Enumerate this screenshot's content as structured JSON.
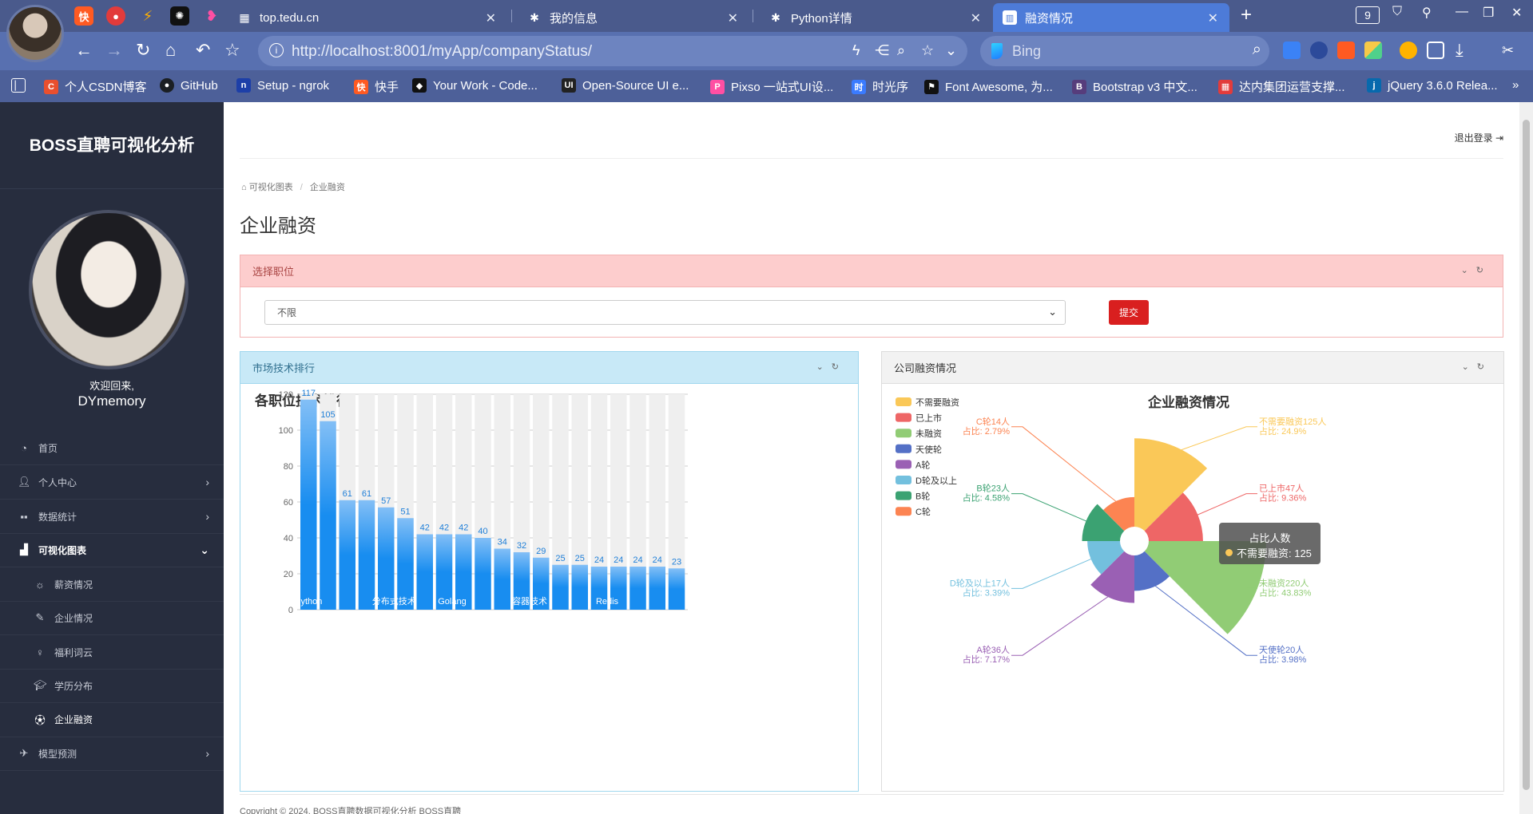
{
  "browser": {
    "tabs": [
      {
        "title": "top.tedu.cn",
        "icon": "grid-icon"
      },
      {
        "title": "我的信息",
        "icon": "bug-icon"
      },
      {
        "title": "Python详情",
        "icon": "bug-icon"
      },
      {
        "title": "融资情况",
        "icon": "trello-icon",
        "active": true
      }
    ],
    "tab_count": "9",
    "url": "http://localhost:8001/myApp/companyStatus/",
    "search_placeholder": "Bing",
    "bookmarks": [
      {
        "label": "个人CSDN博客",
        "color": "#e94f2e",
        "glyph": "C"
      },
      {
        "label": "GitHub",
        "color": "#1b1f23",
        "glyph": "●"
      },
      {
        "label": "Setup - ngrok",
        "color": "#1d3fa8",
        "glyph": "n"
      },
      {
        "label": "快手",
        "color": "#ff5a22",
        "glyph": "快"
      },
      {
        "label": "Your Work - Code...",
        "color": "#111111",
        "glyph": "◆"
      },
      {
        "label": "Open-Source UI e...",
        "color": "#222222",
        "glyph": "UI"
      },
      {
        "label": "Pixso 一站式UI设...",
        "color": "#ff4fa3",
        "glyph": "P"
      },
      {
        "label": "时光序",
        "color": "#3a7bff",
        "glyph": "时"
      },
      {
        "label": "Font Awesome, 为...",
        "color": "#111111",
        "glyph": "⚑"
      },
      {
        "label": "Bootstrap v3 中文...",
        "color": "#563d7c",
        "glyph": "B"
      },
      {
        "label": "达内集团运营支撑...",
        "color": "#e23b3b",
        "glyph": "▦"
      },
      {
        "label": "jQuery 3.6.0 Relea...",
        "color": "#0769ad",
        "glyph": "j"
      }
    ]
  },
  "sidebar": {
    "brand": "BOSS直聘可视化分析",
    "welcome": "欢迎回来,",
    "username": "DYmemory",
    "items": [
      {
        "label": "首页",
        "icon": "dashboard-icon"
      },
      {
        "label": "个人中心",
        "icon": "user-icon"
      },
      {
        "label": "数据统计",
        "icon": "grid-icon"
      },
      {
        "label": "可视化图表",
        "icon": "bar-chart-icon"
      },
      {
        "label": "薪资情况",
        "icon": "sun-icon"
      },
      {
        "label": "企业情况",
        "icon": "feather-icon"
      },
      {
        "label": "福利词云",
        "icon": "bulb-icon"
      },
      {
        "label": "学历分布",
        "icon": "graduation-icon"
      },
      {
        "label": "企业融资",
        "icon": "ball-icon"
      },
      {
        "label": "模型预测",
        "icon": "plane-icon"
      }
    ]
  },
  "header": {
    "logout": "退出登录",
    "breadcrumb_root": "可视化图表",
    "breadcrumb_sep": "/",
    "breadcrumb_current": "企业融资",
    "page_title": "企业融资"
  },
  "filter": {
    "title": "选择职位",
    "selected": "不限",
    "submit": "提交"
  },
  "tech_panel": {
    "title": "市场技术排行"
  },
  "finance_panel": {
    "title": "公司融资情况"
  },
  "tooltip": {
    "title": "占比人数",
    "text": "不需要融资: 125"
  },
  "footer": "Copyright © 2024. BOSS直聘数据可视化分析 BOSS直聘",
  "chart_data": [
    {
      "type": "bar",
      "title": "各职位技术排行",
      "categories": [
        "Python",
        "",
        "",
        "",
        "分布式技术",
        "",
        "",
        "Golang",
        "",
        "",
        "",
        "容器技术",
        "",
        "",
        "",
        "Redis",
        "",
        "",
        "",
        ""
      ],
      "values": [
        117,
        105,
        61,
        61,
        57,
        51,
        42,
        42,
        42,
        40,
        34,
        32,
        29,
        25,
        25,
        24,
        24,
        24,
        24,
        23
      ],
      "ylim": [
        0,
        120
      ],
      "yticks": [
        0,
        20,
        40,
        60,
        80,
        100,
        120
      ],
      "color": "#1f8fef",
      "grid": true
    },
    {
      "type": "pie",
      "title": "企业融资情况",
      "rose": true,
      "legend_position": "top-left",
      "slices": [
        {
          "name": "不需要融资",
          "value": 125,
          "percent": "24.9%",
          "color": "#fac858"
        },
        {
          "name": "已上市",
          "value": 47,
          "percent": "9.36%",
          "color": "#ee6666"
        },
        {
          "name": "未融资",
          "value": 220,
          "percent": "43.83%",
          "color": "#91cc75"
        },
        {
          "name": "天使轮",
          "value": 20,
          "percent": "3.98%",
          "color": "#5470c6"
        },
        {
          "name": "A轮",
          "value": 36,
          "percent": "7.17%",
          "color": "#9a60b4"
        },
        {
          "name": "D轮及以上",
          "value": 17,
          "percent": "3.39%",
          "color": "#73c0de"
        },
        {
          "name": "B轮",
          "value": 23,
          "percent": "4.58%",
          "color": "#3ba272"
        },
        {
          "name": "C轮",
          "value": 14,
          "percent": "2.79%",
          "color": "#fc8452"
        }
      ],
      "label_prefix": "占比:"
    }
  ]
}
